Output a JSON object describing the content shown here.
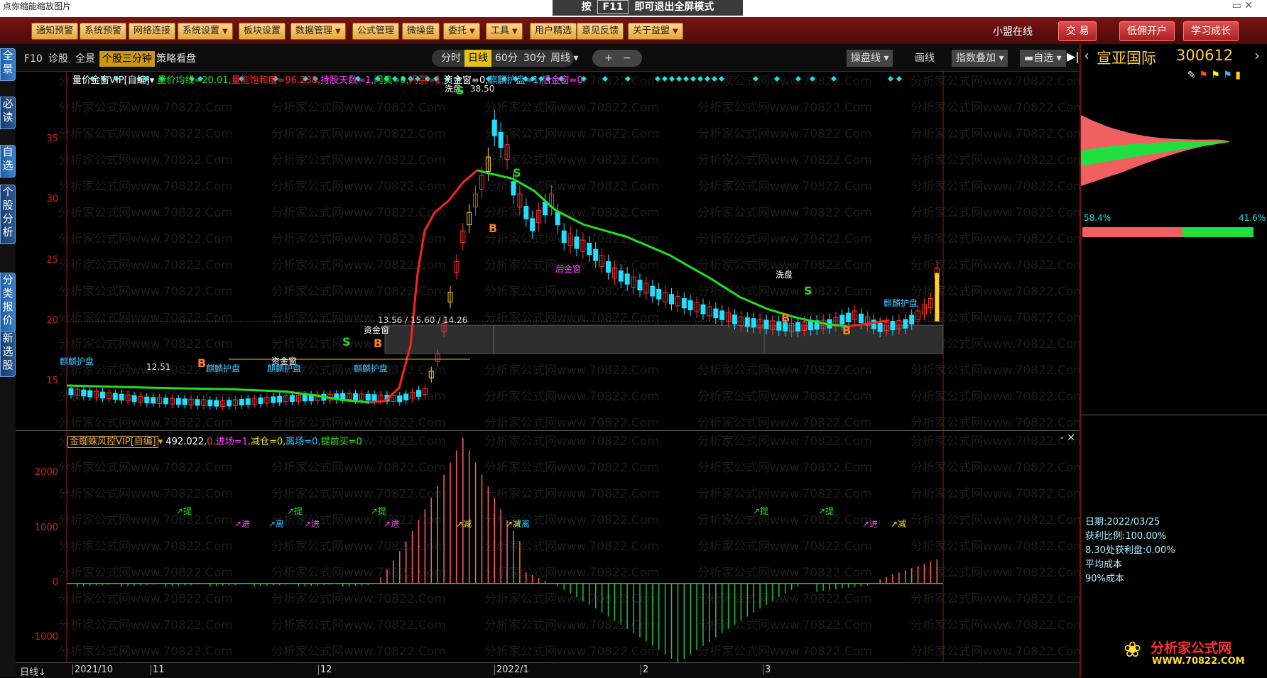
{
  "window": {
    "caption": "点你缩能缩放图片",
    "hint_prefix": "按",
    "hint_key": "F11",
    "hint_suffix": "即可退出全屏模式"
  },
  "menu": {
    "items": [
      {
        "label": "通知预警",
        "drop": false
      },
      {
        "label": "系统预警",
        "drop": false
      },
      {
        "label": "网络连接",
        "drop": false
      },
      {
        "label": "系统设置",
        "drop": true
      },
      {
        "label": "板块设置",
        "drop": false
      },
      {
        "label": "数据管理",
        "drop": true
      },
      {
        "label": "公式管理",
        "drop": false
      },
      {
        "label": "微操盘",
        "drop": false
      },
      {
        "label": "委托",
        "drop": true
      },
      {
        "label": "工具",
        "drop": true
      },
      {
        "label": "用户精选",
        "drop": false
      },
      {
        "label": "意见反馈",
        "drop": false
      },
      {
        "label": "关于益盟",
        "drop": true
      }
    ],
    "online": "小盟在线",
    "right_buttons": [
      "交 易",
      "低佣开户",
      "学习成长"
    ]
  },
  "left_tabs": [
    "全景",
    "必读",
    "自选",
    "个股分析",
    "分类报价",
    "新选股"
  ],
  "chart_tabs": [
    "F10",
    "诊股",
    "全景",
    "个股三分钟",
    "策略看盘"
  ],
  "chart_tabs_selected": "个股三分钟",
  "periods": [
    "分时",
    "日线",
    "60分",
    "30分",
    "周线"
  ],
  "period_selected": "日线",
  "zoom": [
    "+",
    "−"
  ],
  "toolbar_right": [
    "操盘线",
    "画线",
    "指数叠加",
    "自选"
  ],
  "main_legend": {
    "name": "量价金窗VIP[自编]",
    "items": [
      {
        "text": "量价均线=20.01",
        "color": "#20e020"
      },
      {
        "text": "量能饱和度=96.238",
        "color": "#ff3030"
      },
      {
        "text": "持股天数=1",
        "color": "#ff40ff"
      },
      {
        "text": "闪卖=0",
        "color": "#20e020"
      },
      {
        "text": "闪买=1",
        "color": "#ff3030"
      },
      {
        "text": "资金窗=0",
        "color": "#ffffff"
      },
      {
        "text": "麒麟护盘=1",
        "color": "#40c0ff"
      },
      {
        "text": "后金窗=0",
        "color": "#ff40ff"
      }
    ]
  },
  "sub_legend": {
    "name": "金蜘蛛风控VIP[自编]",
    "items": [
      {
        "text": "492.022",
        "color": "#ffffff"
      },
      {
        "text": "0",
        "color": "#ff3030"
      },
      {
        "text": "进场=1",
        "color": "#ff40ff"
      },
      {
        "text": "减仓=0",
        "color": "#e6e020"
      },
      {
        "text": "离场=0",
        "color": "#20c0ff"
      },
      {
        "text": "提前买=0",
        "color": "#20e020"
      }
    ]
  },
  "annotations": {
    "peak": "38.50",
    "low": "12.51",
    "window_price": "13.56 / 15.60 / 14.26",
    "xijin": "洗盘",
    "zijin": "资金窗",
    "qilin": "麒麟护盘",
    "houjin": "后金窗",
    "signal_s": "S",
    "signal_b": "B"
  },
  "sub_marks": {
    "ti": "提",
    "jin": "进",
    "li": "离",
    "jian": "减"
  },
  "chart_data": {
    "type": "candlestick",
    "main_y_ticks": [
      15,
      20,
      25,
      30,
      35
    ],
    "ylim_main": [
      11,
      40
    ],
    "sub_y_ticks": [
      2000,
      1000,
      0,
      -1000
    ],
    "ylim_sub": [
      -1450,
      2650
    ],
    "x_labels": [
      "2021/10",
      "11",
      "12",
      "2022/1",
      "2",
      "3"
    ]
  },
  "stock": {
    "name": "宣亚国际",
    "code": "300612"
  },
  "distribution": {
    "left_pct": "58.4%",
    "right_pct": "41.6%"
  },
  "info": [
    "日期:2022/03/25",
    "获利比例:100.00%",
    "8.30处获利盘:0.00%",
    "平均成本",
    "90%成本"
  ],
  "datebar_label": "日线",
  "logo": {
    "title": "分析家公式网",
    "url": "WWW.70822.COM"
  },
  "watermark": "分析家公式网www.70822.Com",
  "colors": {
    "up": "#ff3030",
    "down": "#20e0ff",
    "ma": "#20e020",
    "accent": "#e6c01a"
  }
}
